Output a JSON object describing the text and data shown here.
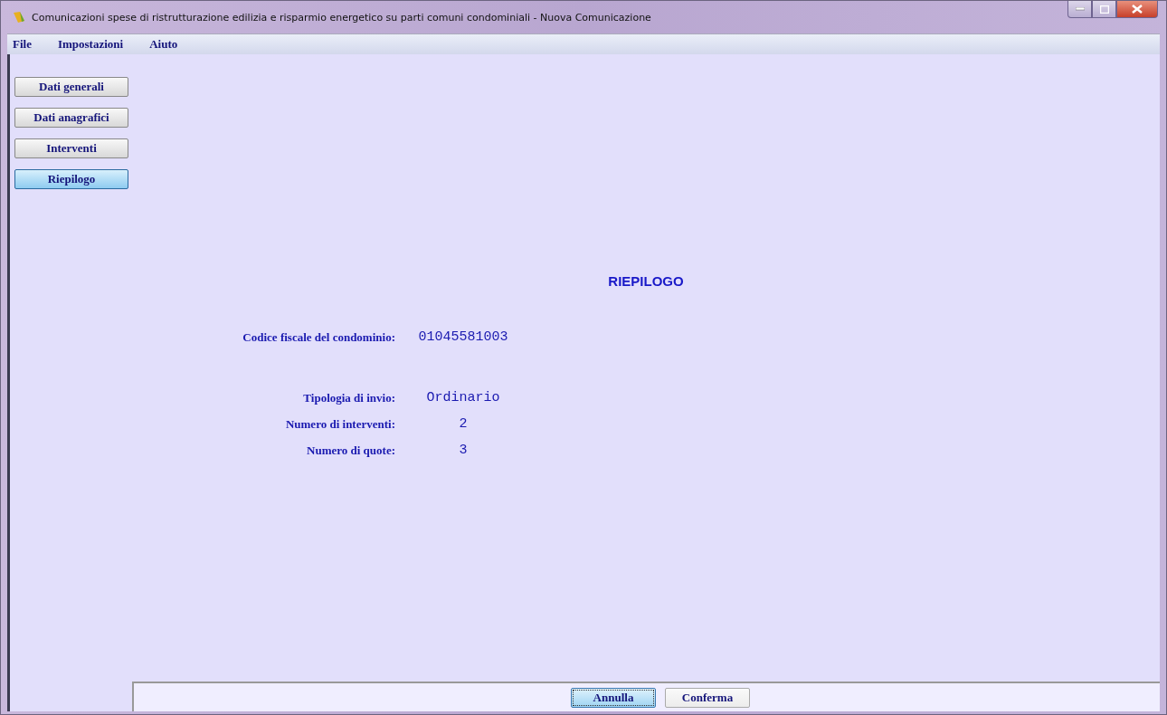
{
  "window": {
    "title": "Comunicazioni spese di ristrutturazione edilizia e risparmio energetico su parti comuni condominiali - Nuova Comunicazione"
  },
  "menu": [
    "File",
    "Impostazioni",
    "Aiuto"
  ],
  "sidebar": {
    "items": [
      {
        "label": "Dati generali",
        "selected": false
      },
      {
        "label": "Dati anagrafici",
        "selected": false
      },
      {
        "label": "Interventi",
        "selected": false
      },
      {
        "label": "Riepilogo",
        "selected": true
      }
    ]
  },
  "summary": {
    "heading": "RIEPILOGO",
    "fields": [
      {
        "label": "Codice fiscale del condominio:",
        "value": "01045581003"
      },
      {
        "label": "Tipologia di invio:",
        "value": "Ordinario"
      },
      {
        "label": "Numero di interventi:",
        "value": "2"
      },
      {
        "label": "Numero di quote:",
        "value": "3"
      }
    ]
  },
  "buttons": [
    {
      "label": "Annulla",
      "focused": true
    },
    {
      "label": "Conferma",
      "focused": false
    }
  ]
}
